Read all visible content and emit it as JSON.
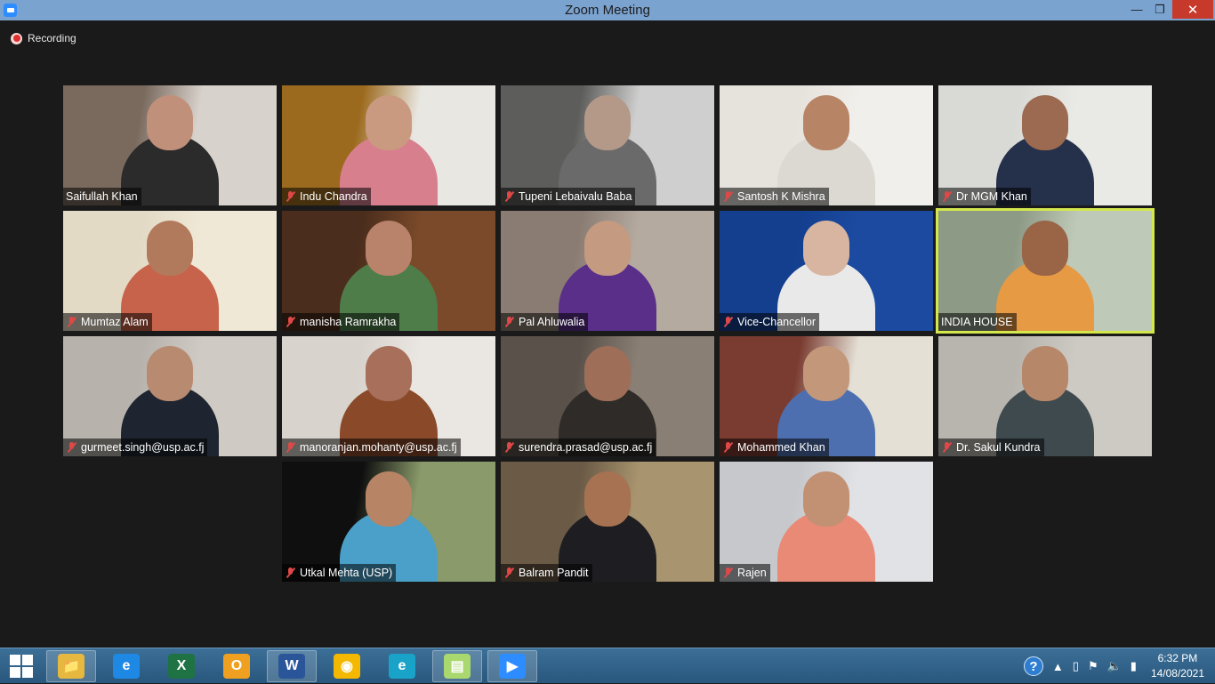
{
  "window": {
    "title": "Zoom Meeting",
    "minimize": "—",
    "maximize": "❐",
    "close": "✕"
  },
  "recording": {
    "label": "Recording"
  },
  "participants": [
    {
      "name": "Saifullah Khan",
      "muted": false,
      "bg": "#7a6a5e",
      "wall": "#d8d2cc",
      "shirt": "#2b2b2b",
      "skin": "#c0907a"
    },
    {
      "name": "Indu Chandra",
      "muted": true,
      "bg": "#9c6a1e",
      "wall": "#e9e7e2",
      "shirt": "#d87f8e",
      "skin": "#c99a80"
    },
    {
      "name": "Tupeni Lebaivalu Baba",
      "muted": true,
      "bg": "#5d5d5b",
      "wall": "#cfcfcf",
      "shirt": "#6a6a6a",
      "skin": "#b49888"
    },
    {
      "name": "Santosh K Mishra",
      "muted": true,
      "bg": "#e6e2dc",
      "wall": "#f1efeb",
      "shirt": "#dcd9d2",
      "skin": "#b88466"
    },
    {
      "name": "Dr MGM Khan",
      "muted": true,
      "bg": "#d9d9d5",
      "wall": "#e9e9e6",
      "shirt": "#25304a",
      "skin": "#9b6a50"
    },
    {
      "name": "Mumtaz Alam",
      "muted": true,
      "bg": "#e3dac6",
      "wall": "#efe8d6",
      "shirt": "#c7634a",
      "skin": "#b27a5c"
    },
    {
      "name": "manisha Ramrakha",
      "muted": true,
      "bg": "#4a2d1c",
      "wall": "#7a4a2a",
      "shirt": "#4f7d4a",
      "skin": "#b9826a"
    },
    {
      "name": "Pal Ahluwalia",
      "muted": true,
      "bg": "#8a7c72",
      "wall": "#b5aaa0",
      "shirt": "#5a2f8a",
      "skin": "#c49a80"
    },
    {
      "name": "Vice-Chancellor",
      "muted": true,
      "bg": "#143f8f",
      "wall": "#1b4aa0",
      "shirt": "#e9e9e9",
      "skin": "#d7b5a0"
    },
    {
      "name": "INDIA HOUSE",
      "muted": false,
      "bg": "#8d9a86",
      "wall": "#bfc9b7",
      "shirt": "#e69a44",
      "skin": "#9a6446",
      "active": true
    },
    {
      "name": "gurmeet.singh@usp.ac.fj",
      "muted": true,
      "bg": "#b7b2ac",
      "wall": "#cfcac4",
      "shirt": "#1e2530",
      "skin": "#b88a70"
    },
    {
      "name": "manoranjan.mohanty@usp.ac.fj",
      "muted": true,
      "bg": "#d8d3cd",
      "wall": "#eae6e1",
      "shirt": "#8a4a2a",
      "skin": "#a8705a"
    },
    {
      "name": "surendra.prasad@usp.ac.fj",
      "muted": true,
      "bg": "#5a524a",
      "wall": "#8a7f74",
      "shirt": "#2e2b28",
      "skin": "#9e6e58"
    },
    {
      "name": "Mohammed Khan",
      "muted": true,
      "bg": "#7a3b30",
      "wall": "#e5e0d6",
      "shirt": "#4d6fb0",
      "skin": "#c3977a"
    },
    {
      "name": "Dr. Sakul Kundra",
      "muted": true,
      "bg": "#b8b4ae",
      "wall": "#cdc9c3",
      "shirt": "#3f4a4e",
      "skin": "#b7876a"
    },
    {
      "name": "Utkal Mehta (USP)",
      "muted": true,
      "bg": "#0f0f0f",
      "wall": "#8a9a6a",
      "shirt": "#4aa0c8",
      "skin": "#b88466"
    },
    {
      "name": "Balram Pandit",
      "muted": true,
      "bg": "#6a5a46",
      "wall": "#a8946e",
      "shirt": "#1e1e22",
      "skin": "#a67252"
    },
    {
      "name": "Rajen",
      "muted": true,
      "bg": "#c6c8cc",
      "wall": "#e0e2e6",
      "shirt": "#e98a76",
      "skin": "#c29174"
    }
  ],
  "taskbar": {
    "apps": [
      {
        "name": "file-explorer-icon",
        "glyph": "📁",
        "color": "#e7b83f",
        "open": true
      },
      {
        "name": "internet-explorer-icon",
        "glyph": "e",
        "color": "#1e88e5",
        "open": false
      },
      {
        "name": "excel-icon",
        "glyph": "X",
        "color": "#1f7244",
        "open": false
      },
      {
        "name": "outlook-icon",
        "glyph": "O",
        "color": "#f0a020",
        "open": false
      },
      {
        "name": "word-icon",
        "glyph": "W",
        "color": "#2a5699",
        "open": true
      },
      {
        "name": "vpn-shield-icon",
        "glyph": "◉",
        "color": "#f5b800",
        "open": false
      },
      {
        "name": "edge-icon",
        "glyph": "e",
        "color": "#1aa3c8",
        "open": false
      },
      {
        "name": "sticky-notes-icon",
        "glyph": "▤",
        "color": "#a9d86e",
        "open": true
      },
      {
        "name": "zoom-icon",
        "glyph": "▶",
        "color": "#2d8cff",
        "open": true
      }
    ],
    "tray": {
      "help": "?",
      "time": "6:32 PM",
      "date": "14/08/2021"
    }
  }
}
